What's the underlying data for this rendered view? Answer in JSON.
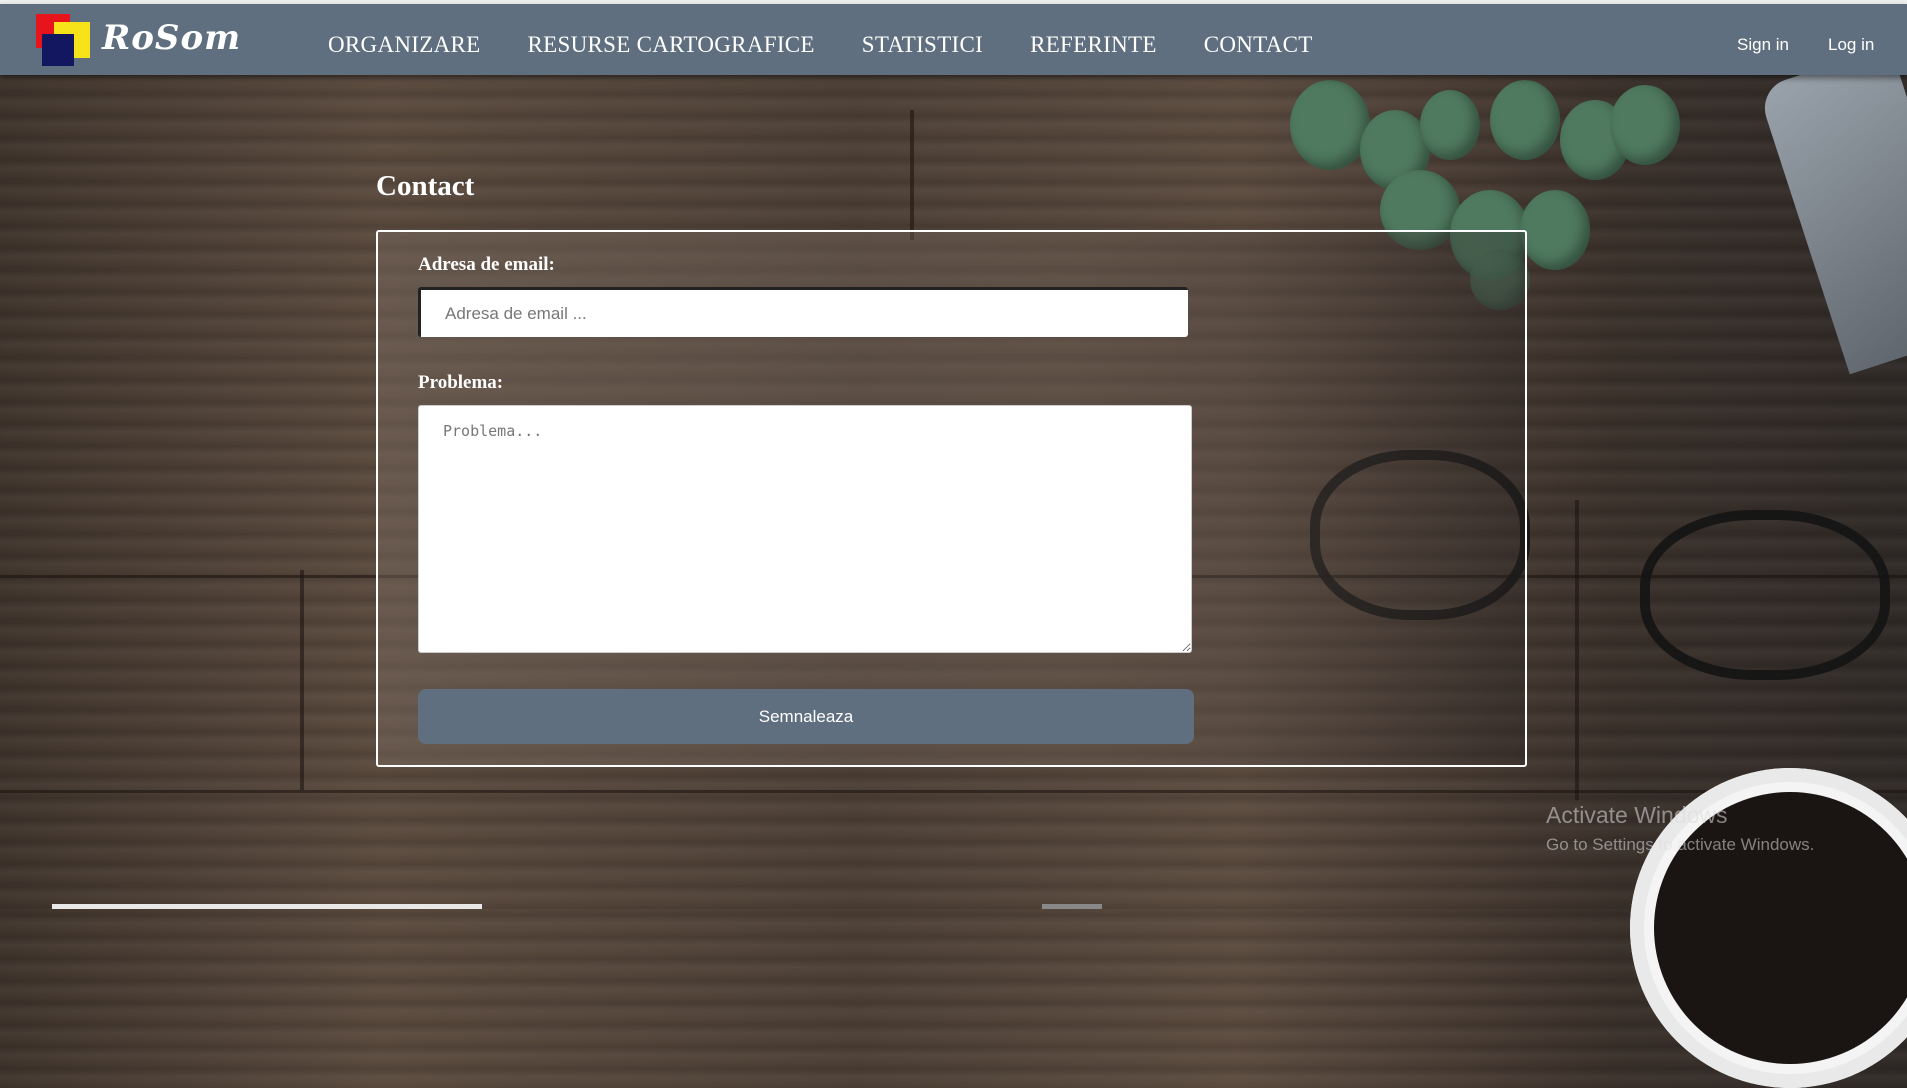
{
  "app": {
    "brand": "RoSom"
  },
  "nav": {
    "items": [
      {
        "label": "ORGANIZARE"
      },
      {
        "label": "RESURSE CARTOGRAFICE"
      },
      {
        "label": "STATISTICI"
      },
      {
        "label": "REFERINTE"
      },
      {
        "label": "CONTACT"
      }
    ],
    "sign_in": "Sign in",
    "log_in": "Log in"
  },
  "page": {
    "title": "Contact"
  },
  "form": {
    "email_label": "Adresa de email:",
    "email_placeholder": "Adresa de email ...",
    "email_value": "",
    "problem_label": "Problema:",
    "problem_placeholder": "Problema...",
    "problem_value": "",
    "submit_label": "Semnaleaza"
  },
  "watermark": {
    "title": "Activate Windows",
    "subtitle": "Go to Settings to activate Windows."
  },
  "colors": {
    "navbar": "#5f6f7f",
    "submit_button": "#5f6f7f",
    "logo_red": "#e8141c",
    "logo_yellow": "#f7e31a",
    "logo_navy": "#121760"
  }
}
